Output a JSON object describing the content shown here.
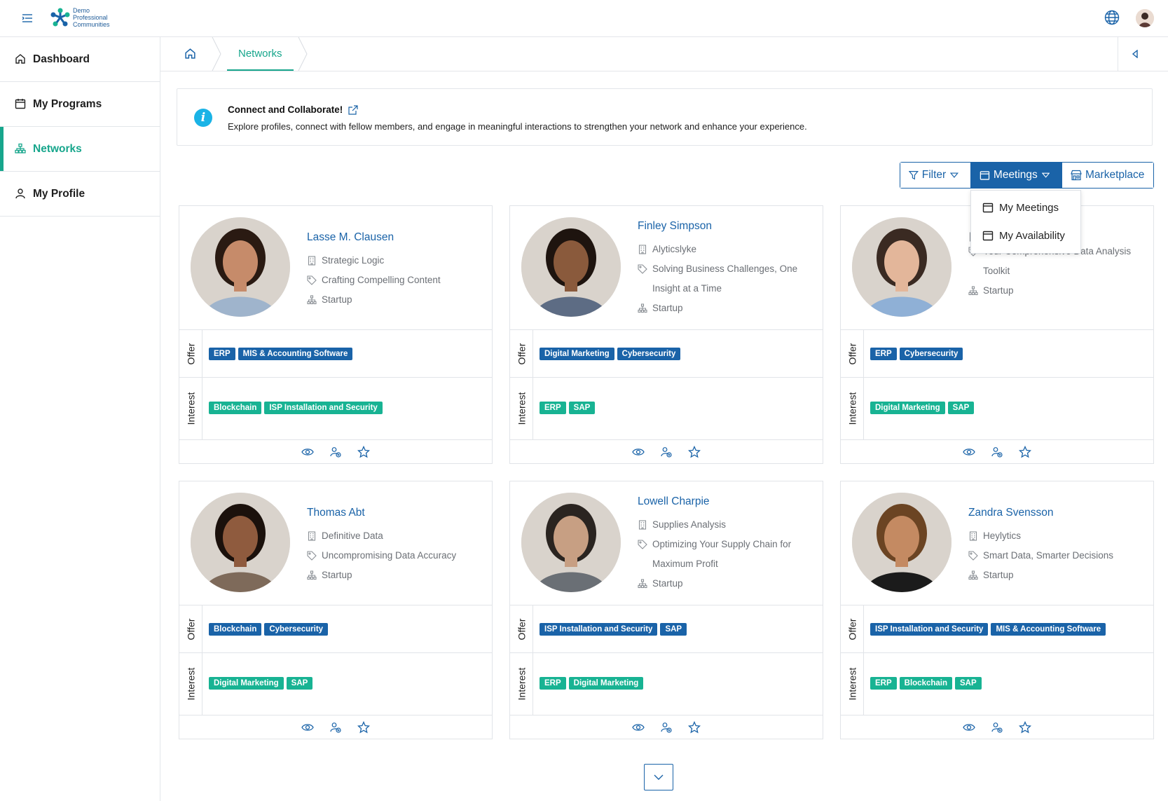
{
  "brand": {
    "line1": "Demo",
    "line2": "Professional",
    "line3": "Communities"
  },
  "sidebar": {
    "items": [
      {
        "label": "Dashboard",
        "icon": "home-icon"
      },
      {
        "label": "My Programs",
        "icon": "calendar-icon"
      },
      {
        "label": "Networks",
        "icon": "network-icon",
        "active": true
      },
      {
        "label": "My Profile",
        "icon": "user-icon"
      }
    ]
  },
  "breadcrumb": {
    "current": "Networks"
  },
  "banner": {
    "title": "Connect and Collaborate!",
    "text": "Explore profiles, connect with fellow members, and engage in meaningful interactions to strengthen your network and enhance your experience."
  },
  "actions": {
    "filter": "Filter",
    "meetings": "Meetings",
    "marketplace": "Marketplace",
    "meetings_menu": [
      "My Meetings",
      "My Availability"
    ]
  },
  "labels": {
    "offer": "Offer",
    "interest": "Interest"
  },
  "colors": {
    "accent": "#17a68c",
    "primary": "#1a63a8",
    "interest": "#18b393",
    "info": "#1ab3e6"
  },
  "profiles": [
    {
      "name": "Lasse M. Clausen",
      "company": "Strategic Logic",
      "tagline": "Crafting Compelling Content",
      "stage": "Startup",
      "offer": [
        "ERP",
        "MIS & Accounting Software"
      ],
      "interest": [
        "Blockchain",
        "ISP Installation and Security"
      ]
    },
    {
      "name": "Finley Simpson",
      "company": "Alyticslyke",
      "tagline": "Solving Business Challenges, One Insight at a Time",
      "stage": "Startup",
      "offer": [
        "Digital Marketing",
        "Cybersecurity"
      ],
      "interest": [
        "ERP",
        "SAP"
      ]
    },
    {
      "name": "",
      "company": "",
      "tagline": "Your Comprehensive Data Analysis Toolkit",
      "stage": "Startup",
      "offer": [
        "ERP",
        "Cybersecurity"
      ],
      "interest": [
        "Digital Marketing",
        "SAP"
      ]
    },
    {
      "name": "Thomas Abt",
      "company": "Definitive Data",
      "tagline": "Uncompromising Data Accuracy",
      "stage": "Startup",
      "offer": [
        "Blockchain",
        "Cybersecurity"
      ],
      "interest": [
        "Digital Marketing",
        "SAP"
      ]
    },
    {
      "name": "Lowell Charpie",
      "company": "Supplies Analysis",
      "tagline": "Optimizing Your Supply Chain for Maximum Profit",
      "stage": "Startup",
      "offer": [
        "ISP Installation and Security",
        "SAP"
      ],
      "interest": [
        "ERP",
        "Digital Marketing"
      ]
    },
    {
      "name": "Zandra Svensson",
      "company": "Heylytics",
      "tagline": "Smart Data, Smarter Decisions",
      "stage": "Startup",
      "offer": [
        "ISP Installation and Security",
        "MIS & Accounting Software"
      ],
      "interest": [
        "ERP",
        "Blockchain",
        "SAP"
      ]
    }
  ]
}
